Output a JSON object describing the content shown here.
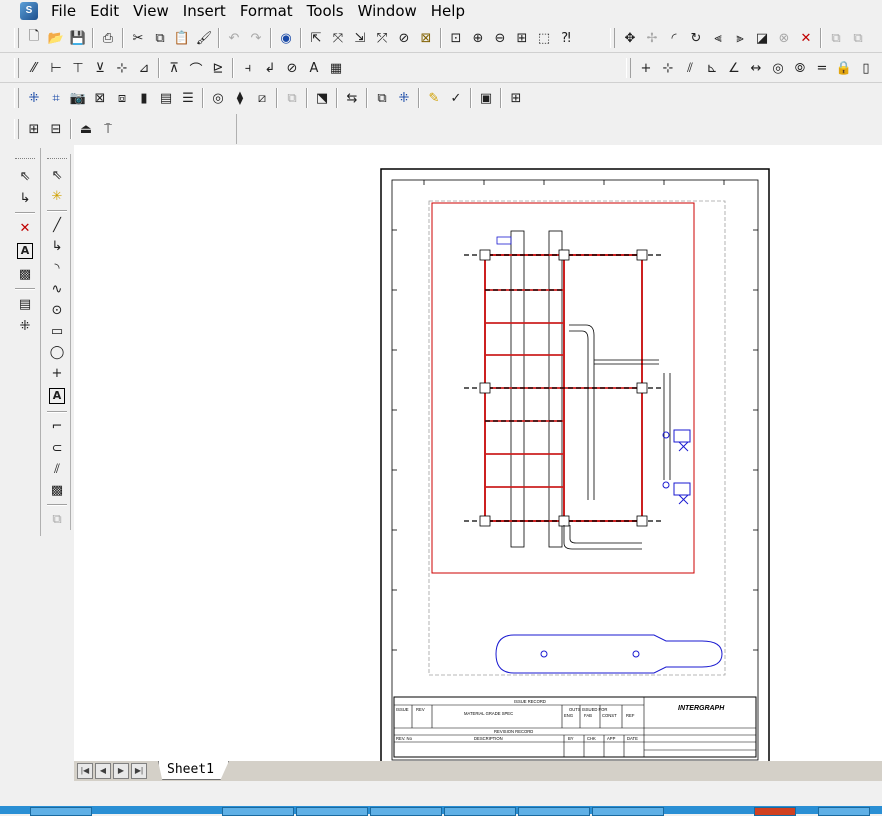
{
  "app": {
    "logo_icon": "intergraph-smartsketch-icon"
  },
  "menu": [
    "File",
    "Edit",
    "View",
    "Insert",
    "Format",
    "Tools",
    "Window",
    "Help"
  ],
  "toolbars": {
    "standard": [
      "new-icon",
      "open-icon",
      "save-icon",
      "print-icon",
      "cut-icon",
      "copy-icon",
      "paste-icon",
      "format-painter-icon",
      "undo-icon",
      "redo-icon",
      "sphere-icon",
      "select-icon",
      "cursor-x-icon",
      "relate-icon",
      "move-icon",
      "rotate-icon",
      "pan-icon",
      "zoom-area-icon",
      "zoom-in-icon",
      "zoom-out-icon",
      "fit-icon",
      "help-icon"
    ],
    "edit_right": [
      "move-cross-icon",
      "move-dim-icon",
      "fillet-icon",
      "spin-icon",
      "mirror-icon",
      "flip-icon",
      "fill-icon",
      "cross-hatch-icon",
      "delete-icon",
      "group-icon",
      "ungroup-icon"
    ]
  },
  "palette_left": [
    "select-tool-icon",
    "connect-tool-icon",
    "delete-tool-icon",
    "text-tool-icon",
    "fill-tool-icon",
    "table-tool-icon",
    "pattern-tool-icon"
  ],
  "palette_right": [
    "select-tool-icon",
    "smart-select-icon",
    "line-tool-icon",
    "polyline-tool-icon",
    "arc-tool-icon",
    "curve-tool-icon",
    "circle-tool-icon",
    "rectangle-tool-icon",
    "ellipse-tool-icon",
    "point-tool-icon",
    "text-box-icon",
    "trim-tool-icon",
    "offset-tool-icon",
    "extend-tool-icon",
    "hatch-tool-icon",
    "image-tool-icon"
  ],
  "drawing": {
    "title_block": {
      "logo": "INTERGRAPH",
      "issue_record": "ISSUE RECORD",
      "issue_no": "ISSUE",
      "rev": "REV",
      "material": "MATERIAL GRADE SPEC",
      "outs_issued": "OUTS ISSUED FOR",
      "cols": [
        "ENG",
        "FAB",
        "CONST",
        "REF"
      ],
      "revision_record": "REVISION RECORD",
      "rev_no": "REV. No",
      "description": "DESCRIPTION",
      "sign_cols": [
        "BY",
        "CHK",
        "APP",
        "DATE"
      ]
    }
  },
  "tabs": {
    "sheet": "Sheet1"
  },
  "colors": {
    "frame_red": "#cc0000",
    "beam_red": "#cc2020",
    "pipe_blue": "#1a1ad0",
    "bg": "#f0f0f0"
  }
}
